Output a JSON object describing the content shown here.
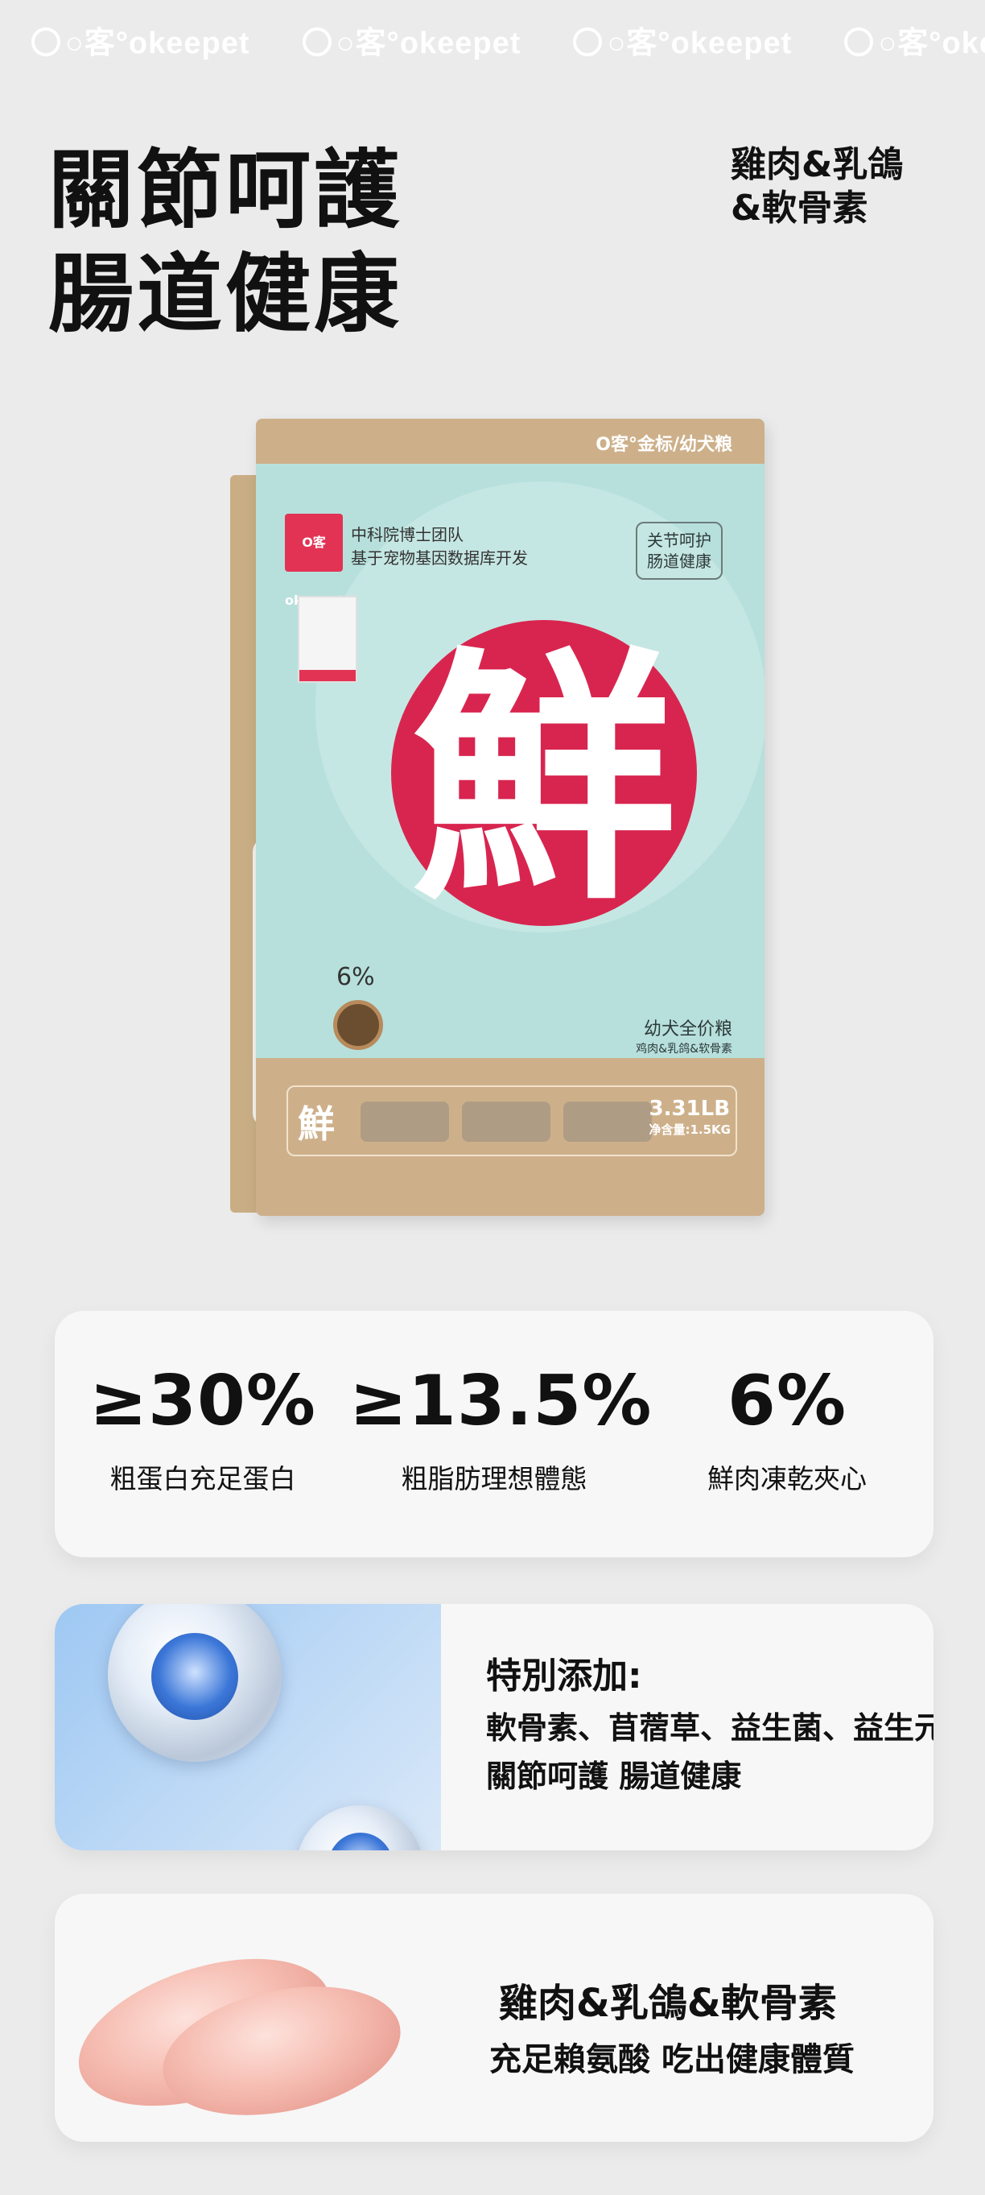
{
  "brand": {
    "logo_text": "○客°okeepet",
    "strip": [
      "t",
      "○客°okeepet",
      "○客°okeepet",
      "○客°okeepet",
      "○客°oke"
    ]
  },
  "headline": {
    "line1": "關節呵護",
    "line2": "腸道健康"
  },
  "flavor": {
    "line1": "雞肉&乳鴿",
    "line2": "&軟骨素"
  },
  "bag": {
    "top_label": "O客°金标/幼犬粮",
    "logo": "O客 okeepet",
    "tagline_1": "中科院博士团队",
    "tagline_2": "基于宠物基因数据库开发",
    "stamp_1": "关节呵护",
    "stamp_2": "肠道健康",
    "center_char": "鮮",
    "pct": "6%",
    "sub_1": "幼犬全价粮",
    "sub_2": "鸡肉&乳鸽&软骨素",
    "bottom_char": "鮮",
    "weight_1": "3.31LB",
    "weight_2": "净含量:1.5KG"
  },
  "stats": [
    {
      "value": "≥30%",
      "label": "粗蛋白充足蛋白"
    },
    {
      "value": "≥13.5%",
      "label": "粗脂肪理想體態"
    },
    {
      "value": "6%",
      "label": "鮮肉凍乾夾心"
    }
  ],
  "additives": {
    "title": "特別添加:",
    "list": "軟骨素、苜蓿草、益生菌、益生元",
    "benefit": "關節呵護 腸道健康"
  },
  "meat": {
    "title": "雞肉&乳鴿&軟骨素",
    "desc": "充足賴氨酸 吃出健康體質"
  },
  "colors": {
    "background": "#ebebeb",
    "bag_teal": "#b7e0dc",
    "bag_kraft": "#cdb08a",
    "accent_red": "#d8254f"
  }
}
